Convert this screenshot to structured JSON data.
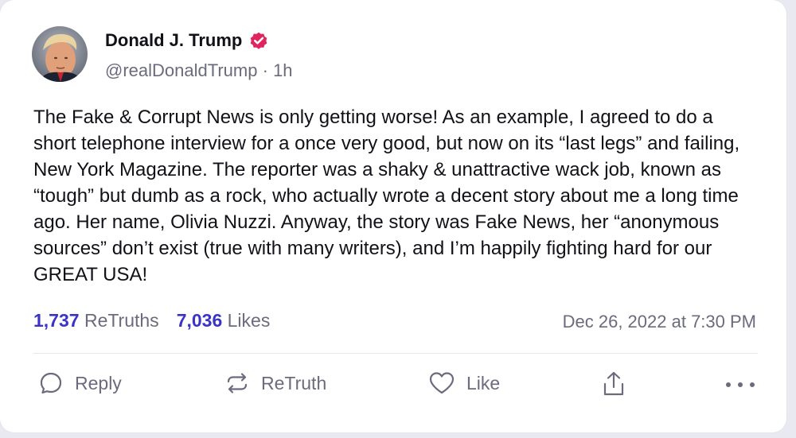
{
  "author": {
    "name": "Donald J. Trump",
    "handle": "@realDonaldTrump",
    "separator": "·",
    "time_ago": "1h",
    "verified_color": "#e0245e"
  },
  "post": {
    "text": "The Fake & Corrupt News is only getting worse! As an example, I agreed to do a short telephone interview for a once very good, but now on its “last legs” and failing, New York Magazine. The reporter was a shaky & unattractive wack job, known as “tough” but dumb as a rock, who actually wrote a decent story about me a long time ago. Her name, Olivia Nuzzi. Anyway, the story was Fake News, her “anonymous sources” don’t exist (true with many writers), and I’m happily fighting hard for our GREAT USA!"
  },
  "stats": {
    "retruths_count": "1,737",
    "retruths_label": "ReTruths",
    "likes_count": "7,036",
    "likes_label": "Likes",
    "accent_color": "#3b33c8"
  },
  "timestamp": "Dec 26, 2022 at 7:30 PM",
  "actions": {
    "reply": {
      "label": "Reply",
      "icon": "reply-icon"
    },
    "retruth": {
      "label": "ReTruth",
      "icon": "retruth-icon"
    },
    "like": {
      "label": "Like",
      "icon": "heart-icon"
    },
    "share": {
      "icon": "share-icon"
    },
    "more": {
      "icon": "more-icon"
    }
  }
}
